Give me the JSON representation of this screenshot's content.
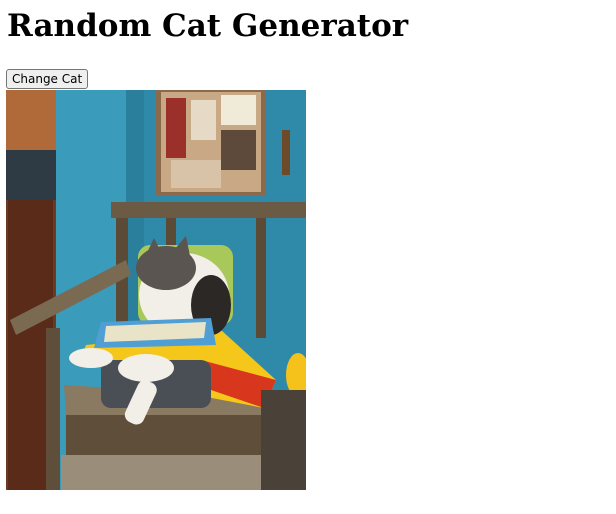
{
  "page": {
    "title": "Random Cat Generator"
  },
  "controls": {
    "change_cat_label": "Change Cat"
  },
  "image": {
    "alt": "cat-photo"
  }
}
